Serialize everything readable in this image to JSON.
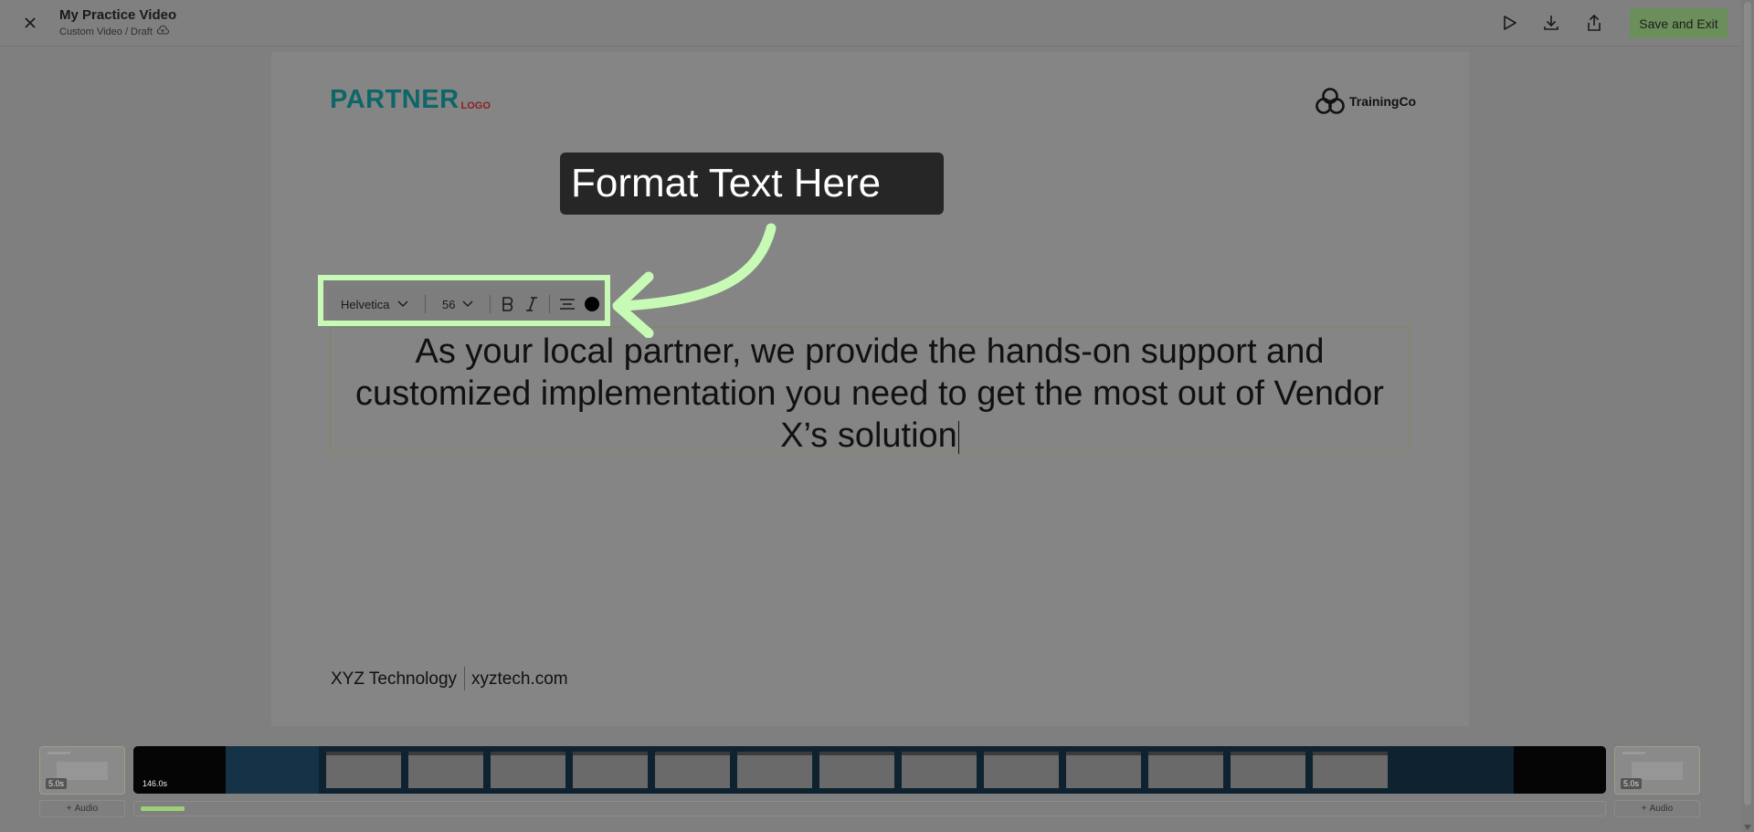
{
  "header": {
    "title": "My Practice Video",
    "subtitle": "Custom Video / Draft",
    "save_exit_label": "Save and Exit",
    "icons": [
      "close-icon",
      "cloud-sync-icon",
      "play-icon",
      "download-icon",
      "share-icon"
    ]
  },
  "slide": {
    "partner_logo_main": "PARTNER",
    "partner_logo_sub": "LOGO",
    "brand_logo_text": "TrainingCo",
    "main_text_line1": "As your local partner, we provide the hands-on support and",
    "main_text_line2": "customized implementation you need to get the most out of Vendor",
    "main_text_line3": "X’s solution",
    "footer_company": "XYZ Technology",
    "footer_website": "xyztech.com"
  },
  "tooltip": {
    "text": "Format Text Here"
  },
  "text_toolbar": {
    "font": "Helvetica",
    "size": "56",
    "text_color": "#000000",
    "icons": [
      "bold-icon",
      "italic-icon",
      "align-center-icon",
      "color-swatch-icon"
    ]
  },
  "timeline": {
    "intro_duration": "5.0s",
    "main_duration": "146.0s",
    "outro_duration": "5.0s",
    "audio_label": "Audio",
    "progress": 0.03
  },
  "colors": {
    "overlay_bg": "#7f7f7f",
    "highlight": "#c7fbb5",
    "tooltip_bg": "#262626",
    "save_button": "#6b8f5a",
    "partner_teal": "#0e6668",
    "partner_red": "#8a2020"
  }
}
